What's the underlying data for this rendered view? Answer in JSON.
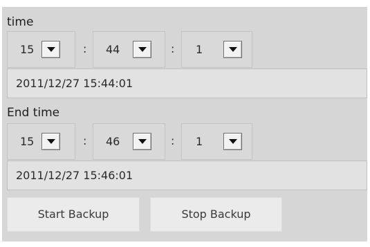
{
  "start": {
    "label": "time",
    "hour": "15",
    "minute": "44",
    "second": "1",
    "separator": ":",
    "datetime": "2011/12/27 15:44:01"
  },
  "end": {
    "label": "End time",
    "hour": "15",
    "minute": "46",
    "second": "1",
    "separator": ":",
    "datetime": "2011/12/27 15:46:01"
  },
  "buttons": {
    "start_backup": "Start Backup",
    "stop_backup": "Stop Backup"
  },
  "icons": {
    "dropdown": "chevron-down-icon"
  }
}
